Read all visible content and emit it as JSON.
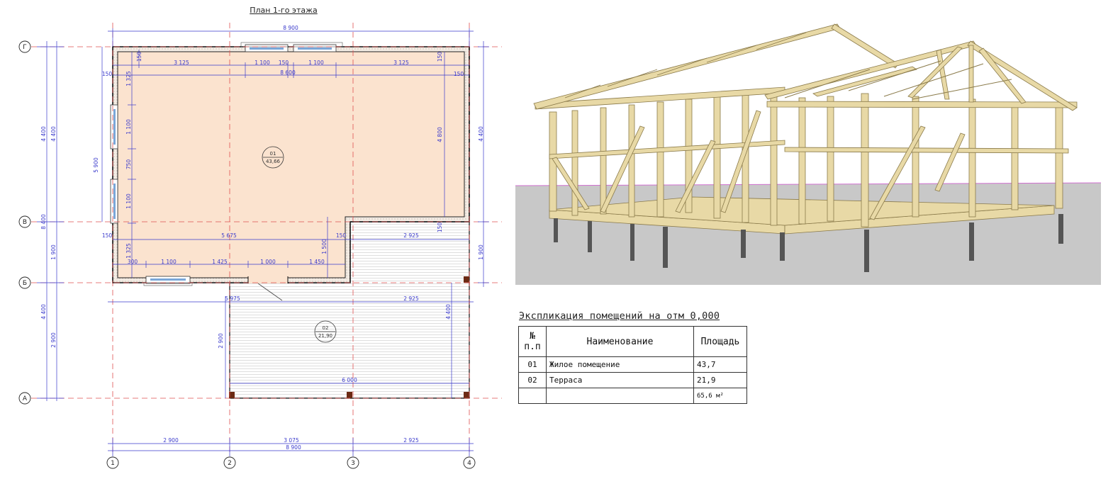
{
  "plan": {
    "title": "План 1-го этажа",
    "axes_letters": [
      "Г",
      "В",
      "Б",
      "А"
    ],
    "axes_numbers": [
      "1",
      "2",
      "3",
      "4"
    ],
    "rooms": [
      {
        "id": "01",
        "area": "43,66"
      },
      {
        "id": "02",
        "area": "21,90"
      }
    ],
    "dims": {
      "overall_top": "8 900",
      "overall_bottom": "8 900",
      "top_chain": [
        "3 125",
        "1 100",
        "150",
        "1 100",
        "3 125"
      ],
      "top_inner": "8 600",
      "top_150_left": "150",
      "top_150_right": "150",
      "top_150_corner": "150",
      "left_outer_chain": [
        "4 400",
        "1 900",
        "4 400",
        "2 900"
      ],
      "left_mid_chain": [
        "4 400",
        "8 400"
      ],
      "left_inner": "5 900",
      "left_window_chain": [
        "1 325",
        "1 100",
        "750",
        "1 100",
        "1 325"
      ],
      "left_150_top": "150",
      "left_150_bottom": "150",
      "mid_chain": "5 675",
      "mid_150": "150",
      "right_terrace_top": "2 925",
      "bottom_window_chain": [
        "300",
        "1 100",
        "1 425",
        "1 000",
        "1 450"
      ],
      "vertical_1500": "1 500",
      "right_inner": "4 800",
      "right_outer_top": "4 400",
      "right_outer_mid": "1 900",
      "right_150": "150",
      "below_b_left": "5 975",
      "below_b_right": "2 925",
      "terrace_height": "2 900",
      "terrace_right_height": "4 400",
      "terrace_width": "6 000",
      "bottom_chain": [
        "2 900",
        "3 075",
        "2 925"
      ]
    }
  },
  "explication": {
    "title": "Экспликация помещений на отм 0,000",
    "headers": {
      "num_line1": "№",
      "num_line2": "п.п",
      "name": "Наименование",
      "area": "Площадь"
    },
    "rows": [
      {
        "num": "01",
        "name": "Жилое помещение",
        "area": "43,7"
      },
      {
        "num": "02",
        "name": "Терраса",
        "area": "21,9"
      }
    ],
    "total": {
      "area": "65,6 м²"
    }
  },
  "colors": {
    "interior_fill": "#fbe3cf",
    "dimension_lines": "#3a3acc",
    "axis_lines": "#e05050",
    "wood": "#e8d9a6",
    "ground": "#c8c8c8"
  }
}
